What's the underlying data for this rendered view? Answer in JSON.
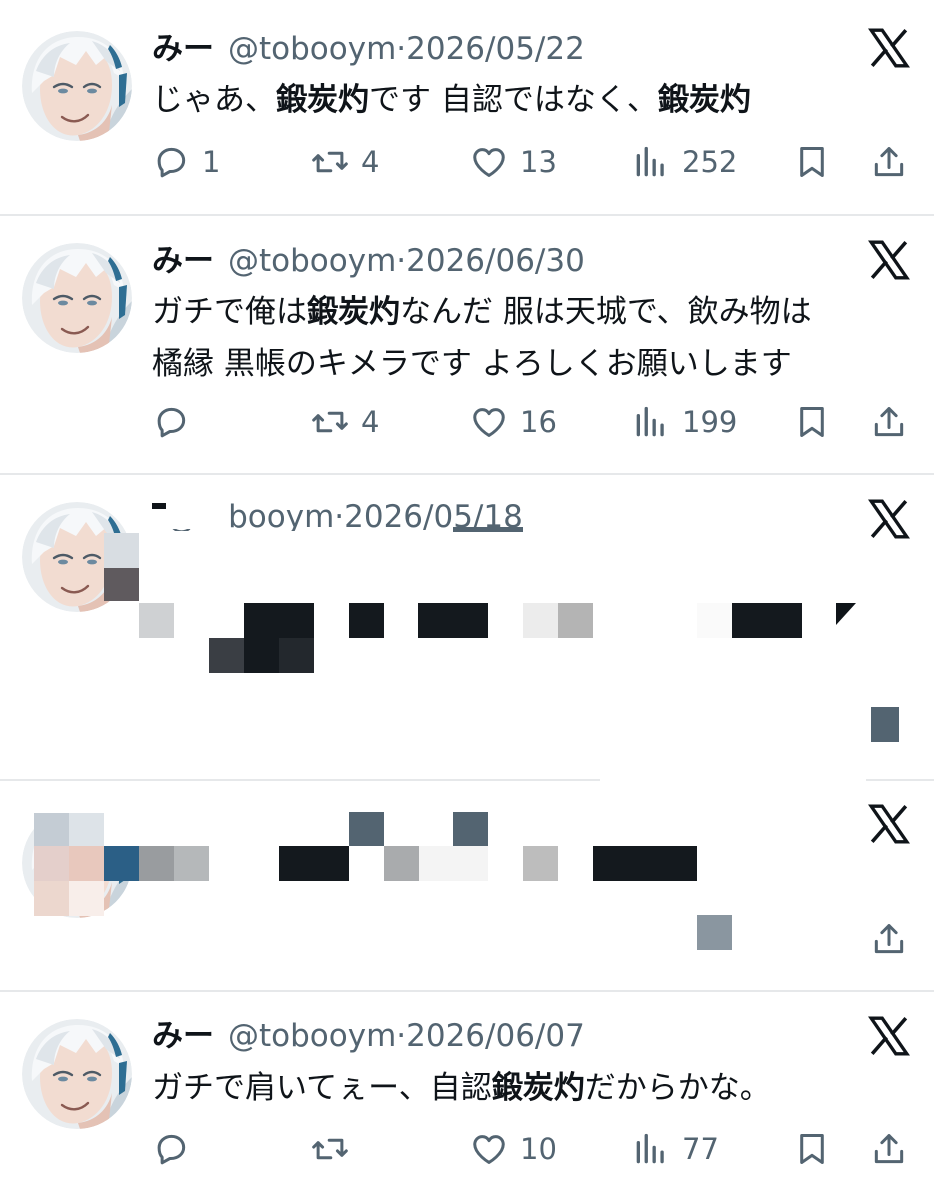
{
  "tweets": [
    {
      "name": "みー",
      "handle": "@tobooym",
      "dot": "·",
      "date": "2026/05/22",
      "lines": [
        [
          {
            "t": "じゃあ、"
          },
          {
            "t": "鍛炭灼",
            "b": true
          },
          {
            "t": "です  自認ではなく、"
          },
          {
            "t": "鍛炭灼",
            "b": true
          }
        ]
      ],
      "counts": {
        "reply": "1",
        "retweet": "4",
        "like": "13",
        "views": "252"
      }
    },
    {
      "name": "みー",
      "handle": "@tobooym",
      "dot": "·",
      "date": "2026/06/30",
      "lines": [
        [
          {
            "t": "ガチで俺は"
          },
          {
            "t": "鍛炭灼",
            "b": true
          },
          {
            "t": "なんだ 服は天城で、飲み物は"
          }
        ],
        [
          {
            "t": "橘縁  黒帳のキメラです よろしくお願いします"
          }
        ]
      ],
      "counts": {
        "reply": "",
        "retweet": "4",
        "like": "16",
        "views": "199"
      }
    },
    {
      "name": "",
      "handle": "@tobooym",
      "dot": "·",
      "date": "2026/05/18",
      "lines": [],
      "counts": {}
    },
    {
      "name": "",
      "handle": "",
      "dot": "",
      "date": "",
      "lines": [],
      "counts": {}
    },
    {
      "name": "みー",
      "handle": "@tobooym",
      "dot": "·",
      "date": "2026/06/07",
      "lines": [
        [
          {
            "t": "ガチで肩いてぇー、自認"
          },
          {
            "t": "鍛炭灼",
            "b": true
          },
          {
            "t": "だからかな。"
          }
        ]
      ],
      "counts": {
        "reply": "",
        "retweet": "",
        "like": "10",
        "views": "77"
      }
    }
  ],
  "icons": {
    "reply": "reply-icon",
    "retweet": "retweet-icon",
    "like": "heart-icon",
    "views": "views-icon",
    "bookmark": "bookmark-icon",
    "share": "share-icon",
    "platform": "x-logo-icon"
  },
  "colors": {
    "text": "#0f1419",
    "secondary": "#536471",
    "divider": "#e6e8ea",
    "background": "#ffffff"
  }
}
